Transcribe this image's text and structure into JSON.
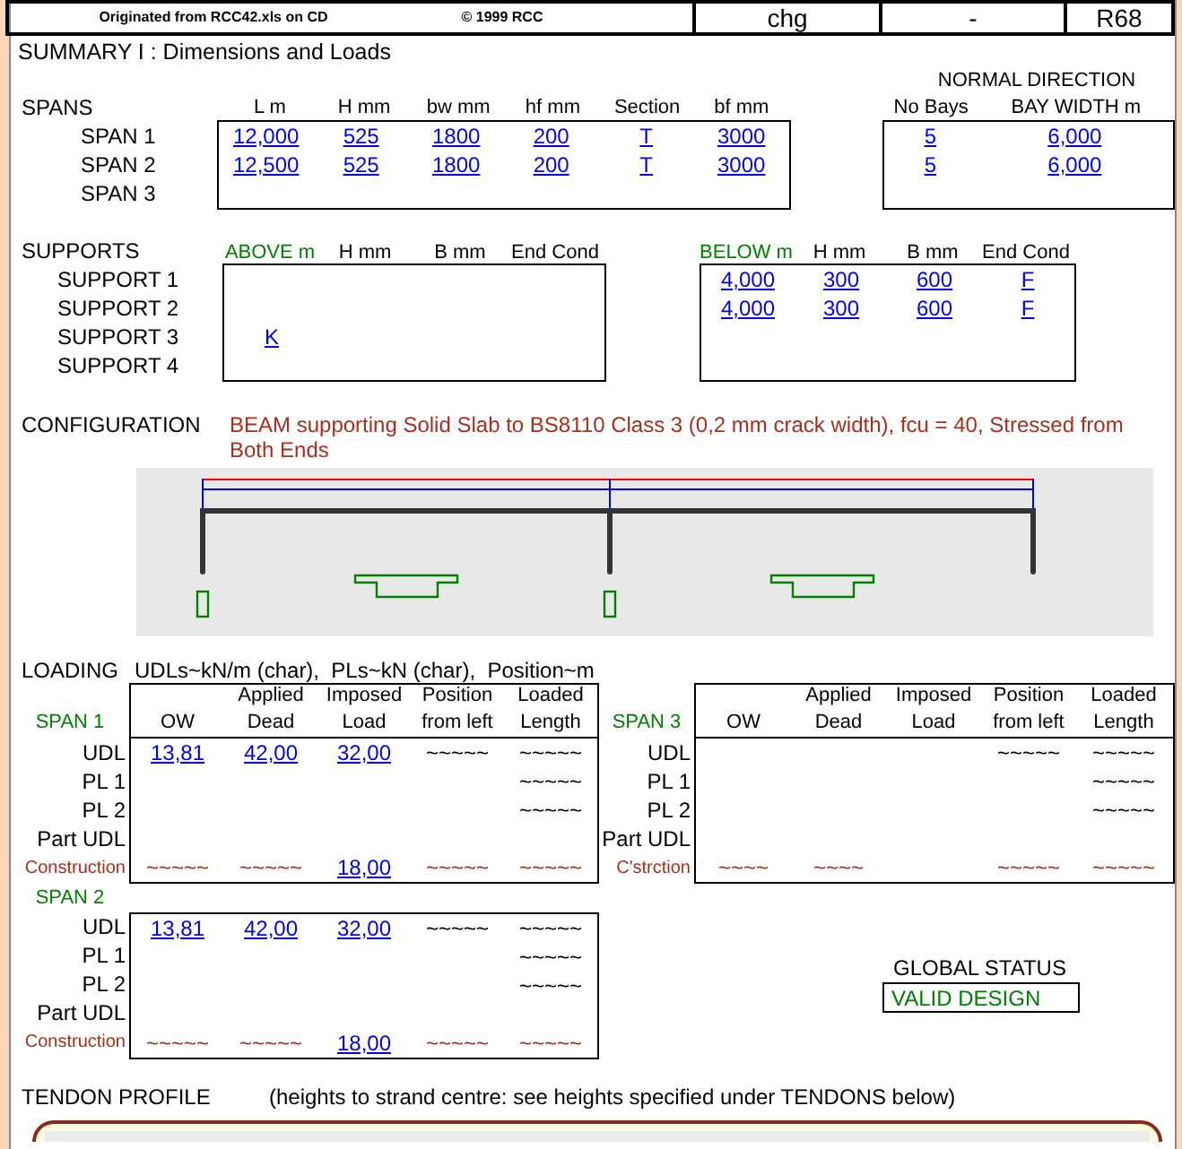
{
  "header": {
    "origin": "Originated from RCC42.xls on CD",
    "copyright": "© 1999 RCC",
    "cells": [
      "chg",
      "-",
      "R68"
    ]
  },
  "title": "SUMMARY I : Dimensions and Loads",
  "spans": {
    "label": "SPANS",
    "columns": [
      "L m",
      "H mm",
      "bw mm",
      "hf mm",
      "Section",
      "bf mm"
    ],
    "normal_direction": {
      "title": "NORMAL DIRECTION",
      "columns": [
        "No Bays",
        "BAY WIDTH m"
      ]
    },
    "rows": [
      {
        "label": "SPAN 1",
        "values": [
          "12,000",
          "525",
          "1800",
          "200",
          "T",
          "3000"
        ],
        "normal": [
          "5",
          "6,000"
        ]
      },
      {
        "label": "SPAN 2",
        "values": [
          "12,500",
          "525",
          "1800",
          "200",
          "T",
          "3000"
        ],
        "normal": [
          "5",
          "6,000"
        ]
      },
      {
        "label": "SPAN 3"
      }
    ]
  },
  "supports": {
    "label": "SUPPORTS",
    "above_columns": [
      "ABOVE m",
      "H mm",
      "B mm",
      "End Cond"
    ],
    "below_columns": [
      "BELOW m",
      "H mm",
      "B mm",
      "End Cond"
    ],
    "rows": [
      {
        "label": "SUPPORT 1",
        "below": [
          "4,000",
          "300",
          "600",
          "F"
        ]
      },
      {
        "label": "SUPPORT 2",
        "below": [
          "4,000",
          "300",
          "600",
          "F"
        ]
      },
      {
        "label": "SUPPORT 3",
        "above": [
          "K"
        ]
      },
      {
        "label": "SUPPORT 4"
      }
    ]
  },
  "configuration": {
    "label": "CONFIGURATION",
    "text": "BEAM supporting Solid Slab to BS8110 Class 3 (0,2 mm crack width), fcu = 40, Stressed from Both Ends"
  },
  "loading": {
    "label": "LOADING",
    "units": "UDLs~kN/m (char),  PLs~kN (char),  Position~m",
    "tables": [
      {
        "span": "SPAN 1",
        "columns": [
          [
            "OW"
          ],
          [
            "Applied",
            "Dead"
          ],
          [
            "Imposed",
            "Load"
          ],
          [
            "Position",
            "from left"
          ],
          [
            "Loaded",
            "Length"
          ]
        ],
        "rows": [
          {
            "label": "UDL",
            "kind": "load",
            "cells": {
              "ow": {
                "text": "13,81",
                "kind": "input"
              },
              "dead": {
                "text": "42,00",
                "kind": "input"
              },
              "imposed": {
                "text": "32,00",
                "kind": "input"
              },
              "position": {
                "text": "~~~~~",
                "kind": "blank"
              },
              "length": {
                "text": "~~~~~",
                "kind": "blank"
              }
            }
          },
          {
            "label": "PL 1",
            "kind": "load",
            "cells": {
              "length": {
                "text": "~~~~~",
                "kind": "blank"
              }
            }
          },
          {
            "label": "PL 2",
            "kind": "load",
            "cells": {
              "length": {
                "text": "~~~~~",
                "kind": "blank"
              }
            }
          },
          {
            "label": "Part UDL",
            "kind": "load",
            "cells": {}
          },
          {
            "label": "Construction",
            "kind": "construction",
            "cells": {
              "ow": {
                "text": "~~~~~",
                "kind": "blank"
              },
              "dead": {
                "text": "~~~~~",
                "kind": "blank"
              },
              "imposed": {
                "text": "18,00",
                "kind": "input"
              },
              "position": {
                "text": "~~~~~",
                "kind": "blank"
              },
              "length": {
                "text": "~~~~~",
                "kind": "blank"
              }
            }
          }
        ]
      },
      {
        "span": "SPAN 3",
        "columns": [
          [
            "OW"
          ],
          [
            "Applied",
            "Dead"
          ],
          [
            "Imposed",
            "Load"
          ],
          [
            "Position",
            "from left"
          ],
          [
            "Loaded",
            "Length"
          ]
        ],
        "rows": [
          {
            "label": "UDL",
            "kind": "load",
            "cells": {
              "position": {
                "text": "~~~~~",
                "kind": "blank"
              },
              "length": {
                "text": "~~~~~",
                "kind": "blank"
              }
            }
          },
          {
            "label": "PL 1",
            "kind": "load",
            "cells": {
              "length": {
                "text": "~~~~~",
                "kind": "blank"
              }
            }
          },
          {
            "label": "PL 2",
            "kind": "load",
            "cells": {
              "length": {
                "text": "~~~~~",
                "kind": "blank"
              }
            }
          },
          {
            "label": "Part UDL",
            "kind": "load",
            "cells": {}
          },
          {
            "label": "C'strction",
            "kind": "construction",
            "cells": {
              "ow": {
                "text": "~~~~",
                "kind": "blank"
              },
              "dead": {
                "text": "~~~~",
                "kind": "blank"
              },
              "position": {
                "text": "~~~~~",
                "kind": "blank"
              },
              "length": {
                "text": "~~~~~",
                "kind": "blank"
              }
            }
          }
        ]
      },
      {
        "span": "SPAN 2",
        "rows": [
          {
            "label": "UDL",
            "kind": "load",
            "cells": {
              "ow": {
                "text": "13,81",
                "kind": "input"
              },
              "dead": {
                "text": "42,00",
                "kind": "input"
              },
              "imposed": {
                "text": "32,00",
                "kind": "input"
              },
              "position": {
                "text": "~~~~~",
                "kind": "blank"
              },
              "length": {
                "text": "~~~~~",
                "kind": "blank"
              }
            }
          },
          {
            "label": "PL 1",
            "kind": "load",
            "cells": {
              "length": {
                "text": "~~~~~",
                "kind": "blank"
              }
            }
          },
          {
            "label": "PL 2",
            "kind": "load",
            "cells": {
              "length": {
                "text": "~~~~~",
                "kind": "blank"
              }
            }
          },
          {
            "label": "Part UDL",
            "kind": "load",
            "cells": {}
          },
          {
            "label": "Construction",
            "kind": "construction",
            "cells": {
              "ow": {
                "text": "~~~~~",
                "kind": "blank"
              },
              "dead": {
                "text": "~~~~~",
                "kind": "blank"
              },
              "imposed": {
                "text": "18,00",
                "kind": "input"
              },
              "position": {
                "text": "~~~~~",
                "kind": "blank"
              },
              "length": {
                "text": "~~~~~",
                "kind": "blank"
              }
            }
          }
        ]
      }
    ]
  },
  "global_status": {
    "label": "GLOBAL STATUS",
    "value": "VALID DESIGN"
  },
  "tendon_profile": {
    "label": "TENDON PROFILE",
    "note": "(heights to strand centre: see heights specified under TENDONS below)"
  }
}
